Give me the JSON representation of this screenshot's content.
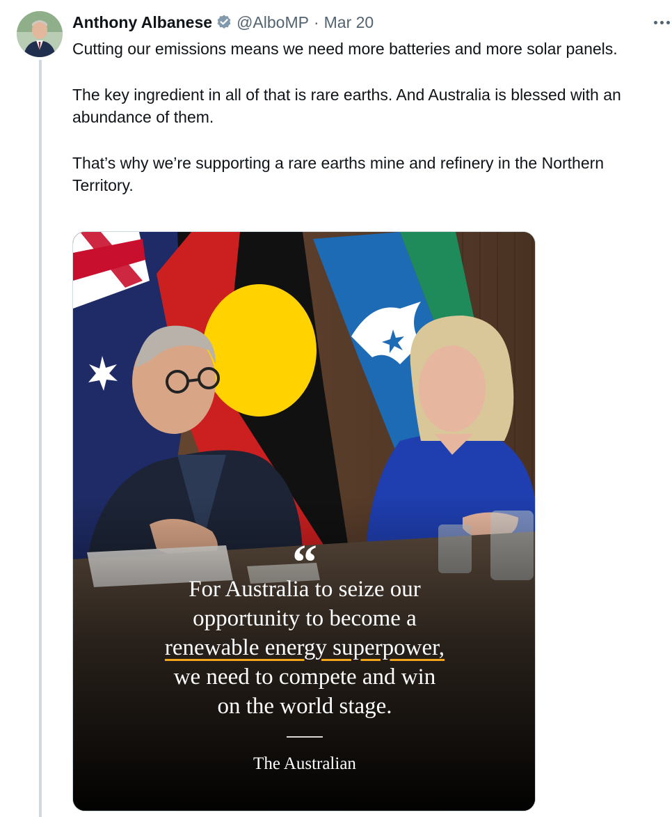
{
  "author": {
    "display_name": "Anthony Albanese",
    "handle": "@AlboMP",
    "separator": "·",
    "date": "Mar 20",
    "verified": true
  },
  "tweet": {
    "paragraphs": [
      "Cutting our emissions means we need more batteries and more solar panels.",
      "The key ingredient in all of that is rare earths. And Australia is blessed with an abundance of them.",
      "That’s why we’re supporting a rare earths mine and refinery in the Northern Territory."
    ]
  },
  "media": {
    "quote_mark": "“",
    "quote_lines": [
      "For Australia to seize our",
      "opportunity to become a",
      "renewable energy superpower,",
      "we need to compete and win",
      "on the world stage."
    ],
    "highlight_phrase": "renewable energy superpower",
    "source": "The Australian"
  },
  "colors": {
    "text_primary": "#0f1419",
    "text_secondary": "#536471",
    "verified_blue": "#829aab",
    "thread_line": "#cfd9de",
    "highlight_underline": "#f2a61b"
  },
  "icons": {
    "verified": "verified-badge-icon",
    "more": "more-horizontal-icon"
  }
}
